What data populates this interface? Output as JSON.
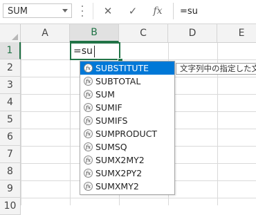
{
  "formula_bar": {
    "name_box": "SUM",
    "cancel_symbol": "✕",
    "enter_symbol": "✓",
    "fx_symbol": "fx",
    "formula": "=su"
  },
  "columns": [
    "A",
    "B",
    "C",
    "D",
    "E"
  ],
  "rows": [
    "1",
    "2",
    "3",
    "4",
    "5",
    "6",
    "7",
    "8",
    "9",
    "10",
    "11"
  ],
  "active_cell": {
    "column": "B",
    "row": "1",
    "value": "=su"
  },
  "autocomplete": {
    "icon_text": "fx",
    "items": [
      "SUBSTITUTE",
      "SUBTOTAL",
      "SUM",
      "SUMIF",
      "SUMIFS",
      "SUMPRODUCT",
      "SUMSQ",
      "SUMX2MY2",
      "SUMX2PY2",
      "SUMXMY2"
    ],
    "selected_index": 0
  },
  "tooltip": "文字列中の指定した文",
  "colors": {
    "accent_green": "#217346",
    "selection_blue": "#0078d7"
  }
}
